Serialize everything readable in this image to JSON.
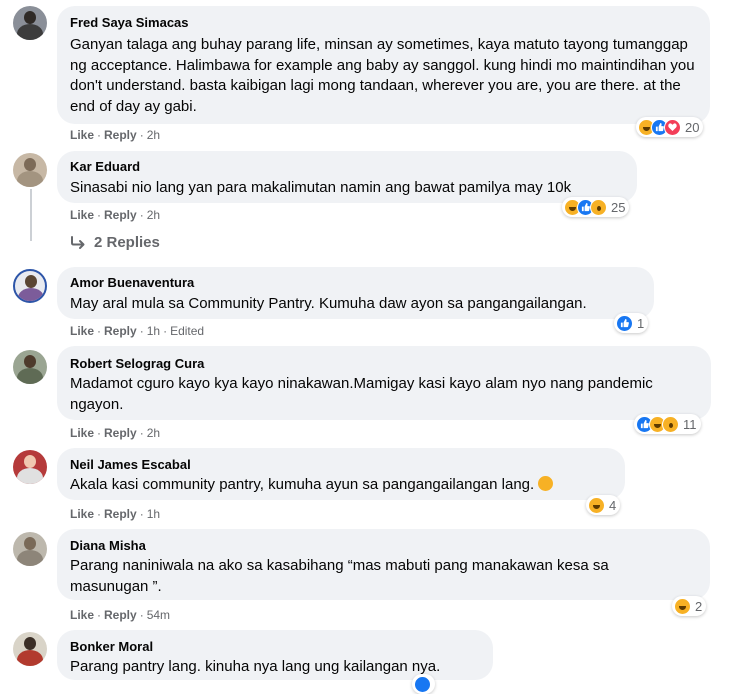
{
  "comments": [
    {
      "author": "Fred Saya Simacas",
      "text": "Ganyan talaga ang buhay parang life, minsan ay sometimes, kaya matuto tayong tumanggap ng acceptance. Halimbawa for example ang baby ay sanggol. kung hindi mo maintindihan you don't understand. basta kaibigan lagi mong tandaan, wherever you are, you are there. at the end of day ay gabi.",
      "like": "Like",
      "reply": "Reply",
      "time": "2h",
      "reactions": [
        "haha",
        "like",
        "love"
      ],
      "reaction_count": "20"
    },
    {
      "author": "Kar Eduard",
      "text": "Sinasabi nio lang yan para makalimutan namin ang bawat pamilya may 10k",
      "like": "Like",
      "reply": "Reply",
      "time": "2h",
      "reactions": [
        "haha",
        "like",
        "wow"
      ],
      "reaction_count": "25",
      "replies_label": "2 Replies"
    },
    {
      "author": "Amor Buenaventura",
      "text": "May aral mula sa Community Pantry. Kumuha daw ayon sa pangangailangan.",
      "like": "Like",
      "reply": "Reply",
      "time": "1h",
      "edited": "Edited",
      "reactions": [
        "like"
      ],
      "reaction_count": "1"
    },
    {
      "author": "Robert Selograg Cura",
      "text": "Madamot cguro kayo kya kayo ninakawan.Mamigay kasi kayo alam nyo nang pandemic ngayon.",
      "like": "Like",
      "reply": "Reply",
      "time": "2h",
      "reactions": [
        "like",
        "haha",
        "wow"
      ],
      "reaction_count": "11"
    },
    {
      "author": "Neil James Escabal",
      "text": "Akala kasi community pantry, kumuha ayun sa pangangailangan lang.",
      "like": "Like",
      "reply": "Reply",
      "time": "1h",
      "reactions": [
        "haha"
      ],
      "reaction_count": "4"
    },
    {
      "author": "Diana Misha",
      "text": "Parang naniniwala na ako sa kasabihang “mas mabuti pang manakawan kesa sa masunugan ”.",
      "like": "Like",
      "reply": "Reply",
      "time": "54m",
      "reactions": [
        "haha"
      ],
      "reaction_count": "2"
    },
    {
      "author": "Bonker Moral",
      "text": "Parang pantry lang. kinuha nya lang ung kailangan nya.",
      "reactions": []
    }
  ],
  "colors": {
    "bubble": "#f0f2f5",
    "meta": "#65676b",
    "text": "#050505",
    "like_blue": "#1877f2",
    "love_red": "#f33e58",
    "emoji_yellow": "#f7b125"
  }
}
